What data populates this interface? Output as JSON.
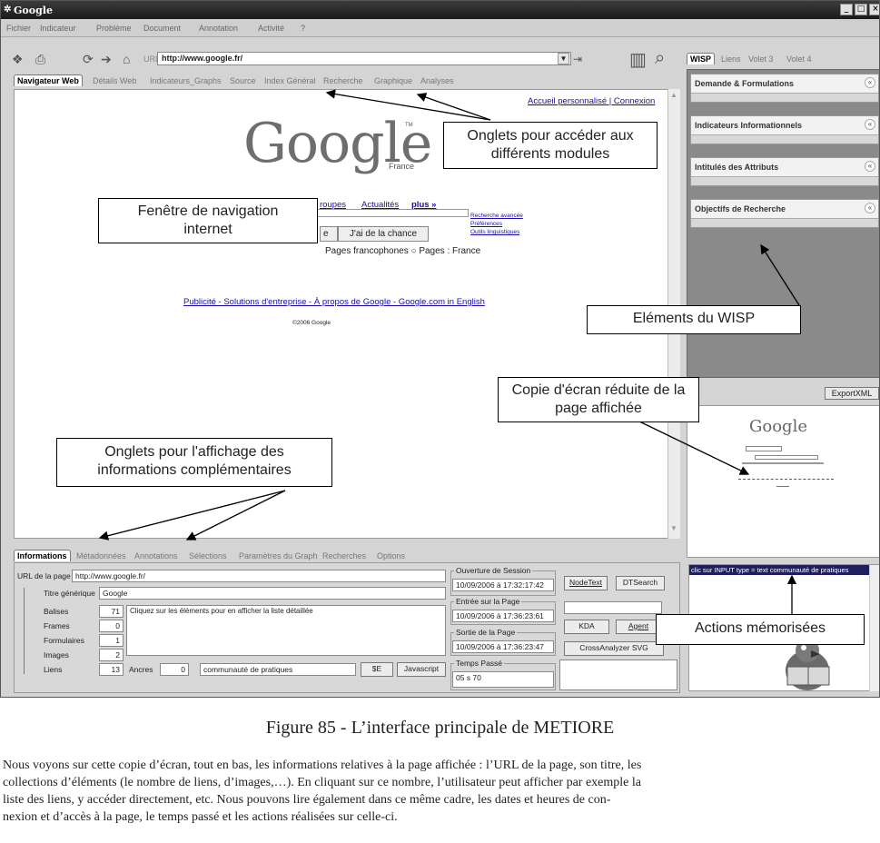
{
  "window": {
    "title": "Google",
    "menu": [
      "Fichier",
      "Indicateur",
      "Problème",
      "Document",
      "Annotation",
      "Activité",
      "?"
    ]
  },
  "toolbar": {
    "url_label": "URL",
    "url_value": "http://www.google.fr/"
  },
  "main_tabs": [
    "Navigateur Web",
    "Détails Web",
    "Indicateurs_Graphs",
    "Source",
    "Index Général",
    "Recherche",
    "Graphique",
    "Analyses"
  ],
  "browser": {
    "top_links": "Accueil personnalisé | Connexion",
    "logo": "Google",
    "logo_sub": "France",
    "nav_links": [
      "roupes",
      "Actualités",
      "plus »"
    ],
    "side_links": [
      "Recherche avancée",
      "Préférences",
      "Outils linguistiques"
    ],
    "btn_search": "e",
    "btn_lucky": "J'ai de la chance",
    "radio_text": "Pages francophones  ○ Pages : France",
    "footer_links": "Publicité - Solutions d'entreprise - À propos de Google - Google.com in English",
    "copyright": "©2006 Google"
  },
  "callouts": {
    "tabs": "Onglets pour accéder aux différents modules",
    "browser": "Fenêtre de navigation internet",
    "wisp": "Eléments du WISP",
    "thumb": "Copie d'écran réduite de la page affichée",
    "bottom_tabs": "Onglets pour l'affichage des informations complémentaires",
    "actions": "Actions mémorisées"
  },
  "wisp": {
    "tabs": [
      "WISP",
      "Liens",
      "Volet 3",
      "Volet 4"
    ],
    "sections": [
      "Demande & Formulations",
      "Indicateurs Informationnels",
      "Intitulés des Attributs",
      "Objectifs de Recherche"
    ],
    "export_button": "ExportXML"
  },
  "bottom_tabs": [
    "Informations",
    "Métadonnées",
    "Annotations",
    "Sélections",
    "Paramètres du Graph",
    "Recherches",
    "Options"
  ],
  "info": {
    "url_label": "URL de la page",
    "url_value": "http://www.google.fr/",
    "rows": [
      {
        "label": "Titre générique",
        "value": "Google"
      },
      {
        "label": "Balises",
        "value": "71"
      },
      {
        "label": "Frames",
        "value": "0"
      },
      {
        "label": "Formulaires",
        "value": "1"
      },
      {
        "label": "Images",
        "value": "2"
      },
      {
        "label": "Liens",
        "value": "13"
      }
    ],
    "balises_hint": "Cliquez sur les éléments pour en afficher la liste détaillée",
    "ancres_label": "Ancres",
    "ancres_value": "0",
    "anchor_text": "communauté de pratiques",
    "btn_se": "$E",
    "btn_js": "Javascript",
    "session_open_label": "Ouverture de Session",
    "session_open_value": "10/09/2006  à  17:32:17:42",
    "page_entry_label": "Entrée sur la Page",
    "page_entry_value": "10/09/2006  à  17:36:23:61",
    "page_exit_label": "Sortie de la Page",
    "page_exit_value": "10/09/2006  à  17:36:23:47",
    "time_spent_label": "Temps Passé",
    "time_spent_value": "05 s 70",
    "btn_nodetext": "NodeText",
    "btn_dtsearch": "DTSearch",
    "btn_kda": "KDA",
    "btn_agent": "Agent",
    "btn_crossanalyzer": "CrossAnalyzer SVG"
  },
  "actions_log": "clic sur INPUT type = text    communauté de pratiques",
  "caption": "Figure 85 - L’interface principale de METIORE",
  "paragraph": [
    "Nous voyons sur cette copie d’écran, tout en bas, les informations relatives à la page affichée : l’URL de la page, son titre, les",
    "collections d’éléments (le nombre de liens, d’images,…). En cliquant sur ce nombre, l’utilisateur peut afficher par exemple la",
    "liste des liens, y accéder directement, etc.  Nous pouvons lire également dans ce même cadre, les dates et heures de con-",
    "nexion et d’accès à la page, le temps passé et les actions réalisées sur celle-ci."
  ]
}
